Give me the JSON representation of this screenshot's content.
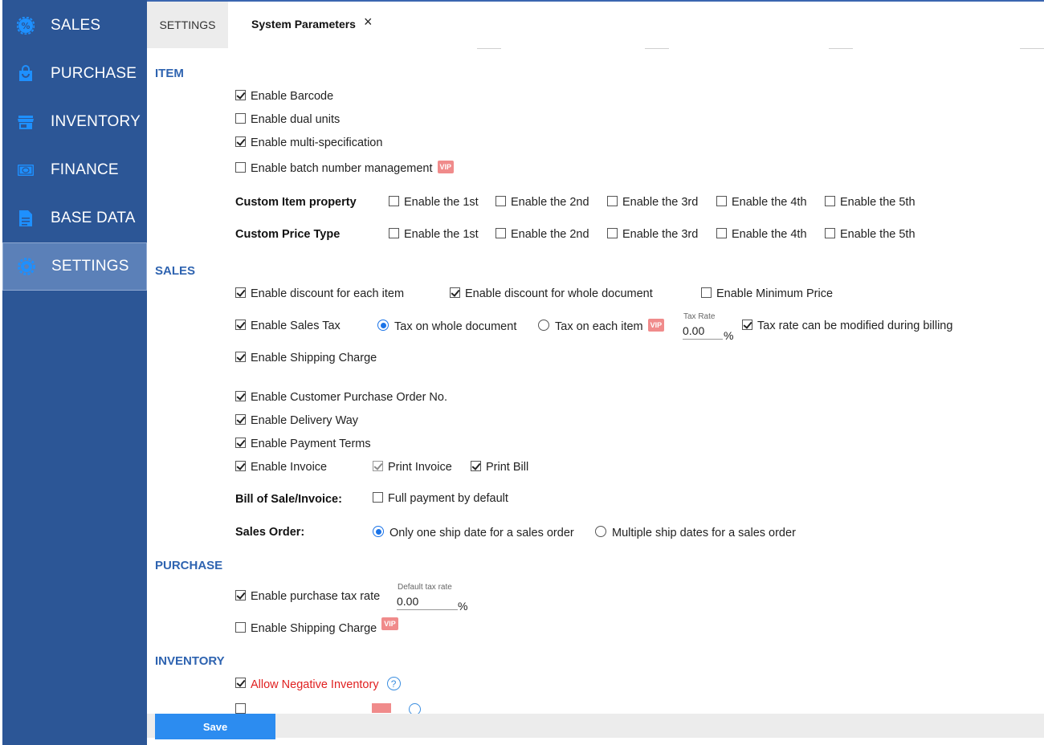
{
  "sidebar": {
    "items": [
      {
        "label": "SALES",
        "icon": "percent-gear-icon"
      },
      {
        "label": "PURCHASE",
        "icon": "shopping-bag-icon"
      },
      {
        "label": "INVENTORY",
        "icon": "store-icon"
      },
      {
        "label": "FINANCE",
        "icon": "money-icon"
      },
      {
        "label": "BASE DATA",
        "icon": "document-icon"
      },
      {
        "label": "SETTINGS",
        "icon": "gear-icon",
        "active": true
      }
    ]
  },
  "tabs": {
    "settings": "SETTINGS",
    "params": "System Parameters",
    "close": "×"
  },
  "item": {
    "title": "ITEM",
    "barcode": "Enable Barcode",
    "dual_units": "Enable dual units",
    "multi_spec": "Enable multi-specification",
    "batch": "Enable batch number management",
    "custom_property_label": "Custom Item property",
    "custom_price_label": "Custom Price Type",
    "enable_1": "Enable the 1st",
    "enable_2": "Enable the 2nd",
    "enable_3": "Enable the 3rd",
    "enable_4": "Enable the 4th",
    "enable_5": "Enable the 5th"
  },
  "vip": "VIP",
  "sales": {
    "title": "SALES",
    "discount_item": "Enable discount for each item",
    "discount_doc": "Enable discount for whole document",
    "min_price": "Enable Minimum Price",
    "sales_tax": "Enable Sales Tax",
    "tax_whole": "Tax on whole document",
    "tax_each": "Tax on each item",
    "tax_rate_label": "Tax Rate",
    "tax_rate_value": "0.00",
    "percent": "%",
    "tax_modify": "Tax rate can be modified during billing",
    "shipping": "Enable Shipping Charge",
    "customer_po": "Enable Customer Purchase Order No.",
    "delivery": "Enable Delivery Way",
    "payment_terms": "Enable Payment Terms",
    "invoice": "Enable Invoice",
    "print_invoice": "Print Invoice",
    "print_bill": "Print Bill",
    "bill_label": "Bill of Sale/Invoice:",
    "full_payment": "Full payment by default",
    "order_label": "Sales Order:",
    "one_ship": "Only one ship date for a sales order",
    "multi_ship": "Multiple ship dates for a sales order"
  },
  "purchase": {
    "title": "PURCHASE",
    "tax_rate": "Enable purchase tax rate",
    "default_tax_label": "Default tax rate",
    "default_tax_value": "0.00",
    "percent": "%",
    "shipping": "Enable Shipping Charge"
  },
  "inventory": {
    "title": "INVENTORY",
    "negative": "Allow Negative Inventory",
    "help": "?"
  },
  "footer": {
    "save": "Save"
  },
  "colors": {
    "sidebar": "#2c5696",
    "sidebar_active": "#5b80b8",
    "accent": "#2e63b0",
    "save": "#2c8cf0",
    "vip": "#f08b8b",
    "warning_text": "#e02020"
  }
}
